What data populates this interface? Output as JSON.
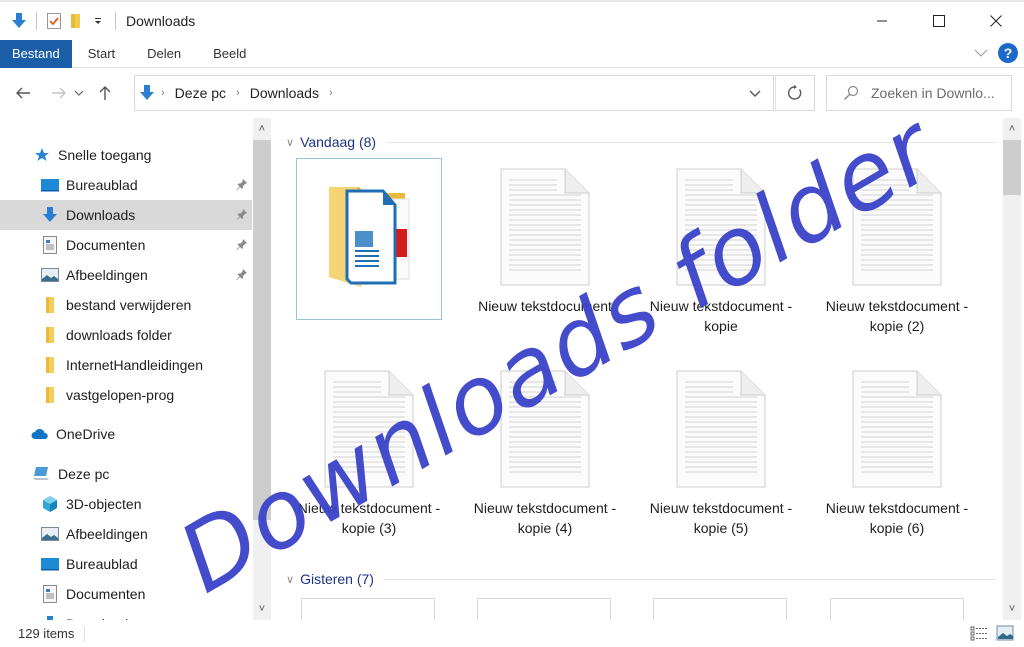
{
  "window": {
    "title": "Downloads",
    "quick_access_toolbar": [
      "download-arrow-icon",
      "properties-icon",
      "new-folder-icon",
      "customize-dropdown-icon"
    ],
    "controls": {
      "minimize": "minimize-icon",
      "maximize": "maximize-icon",
      "close": "close-icon"
    }
  },
  "ribbon": {
    "tabs": [
      {
        "label": "Bestand",
        "active": true
      },
      {
        "label": "Start"
      },
      {
        "label": "Delen"
      },
      {
        "label": "Beeld"
      }
    ],
    "help_label": "?"
  },
  "navbar": {
    "breadcrumb": [
      "Deze pc",
      "Downloads"
    ],
    "search_placeholder": "Zoeken in Downlo..."
  },
  "sidebar": {
    "quick_access_label": "Snelle toegang",
    "quick_access": [
      {
        "label": "Bureaublad",
        "icon": "desktop-icon",
        "pinned": true
      },
      {
        "label": "Downloads",
        "icon": "download-icon",
        "pinned": true,
        "selected": true
      },
      {
        "label": "Documenten",
        "icon": "documents-icon",
        "pinned": true
      },
      {
        "label": "Afbeeldingen",
        "icon": "pictures-icon",
        "pinned": true
      },
      {
        "label": "bestand verwijderen",
        "icon": "folder-icon"
      },
      {
        "label": "downloads folder",
        "icon": "folder-icon"
      },
      {
        "label": "InternetHandleidingen",
        "icon": "folder-icon"
      },
      {
        "label": "vastgelopen-prog",
        "icon": "folder-icon"
      }
    ],
    "onedrive_label": "OneDrive",
    "this_pc_label": "Deze pc",
    "this_pc": [
      {
        "label": "3D-objecten",
        "icon": "3d-objects-icon"
      },
      {
        "label": "Afbeeldingen",
        "icon": "pictures-icon"
      },
      {
        "label": "Bureaublad",
        "icon": "desktop-icon"
      },
      {
        "label": "Documenten",
        "icon": "documents-icon"
      },
      {
        "label": "Downloads",
        "icon": "download-icon"
      }
    ]
  },
  "content": {
    "groups": [
      {
        "label": "Vandaag (8)",
        "items": [
          {
            "name": "",
            "type": "folder",
            "selected": true
          },
          {
            "name": "Nieuw tekstdocument",
            "type": "text"
          },
          {
            "name": "Nieuw tekstdocument - kopie",
            "type": "text"
          },
          {
            "name": "Nieuw tekstdocument - kopie (2)",
            "type": "text"
          },
          {
            "name": "Nieuw tekstdocument - kopie (3)",
            "type": "text"
          },
          {
            "name": "Nieuw tekstdocument - kopie (4)",
            "type": "text"
          },
          {
            "name": "Nieuw tekstdocument - kopie (5)",
            "type": "text"
          },
          {
            "name": "Nieuw tekstdocument - kopie (6)",
            "type": "text"
          }
        ]
      },
      {
        "label": "Gisteren (7)"
      }
    ]
  },
  "status": {
    "item_count": "129 items"
  },
  "watermark": {
    "text": "Downloads folder",
    "color": "#3a43c9"
  },
  "colors": {
    "accent": "#1a5ea8",
    "group_header": "#1e3287",
    "selection": "#d9d9d9"
  }
}
